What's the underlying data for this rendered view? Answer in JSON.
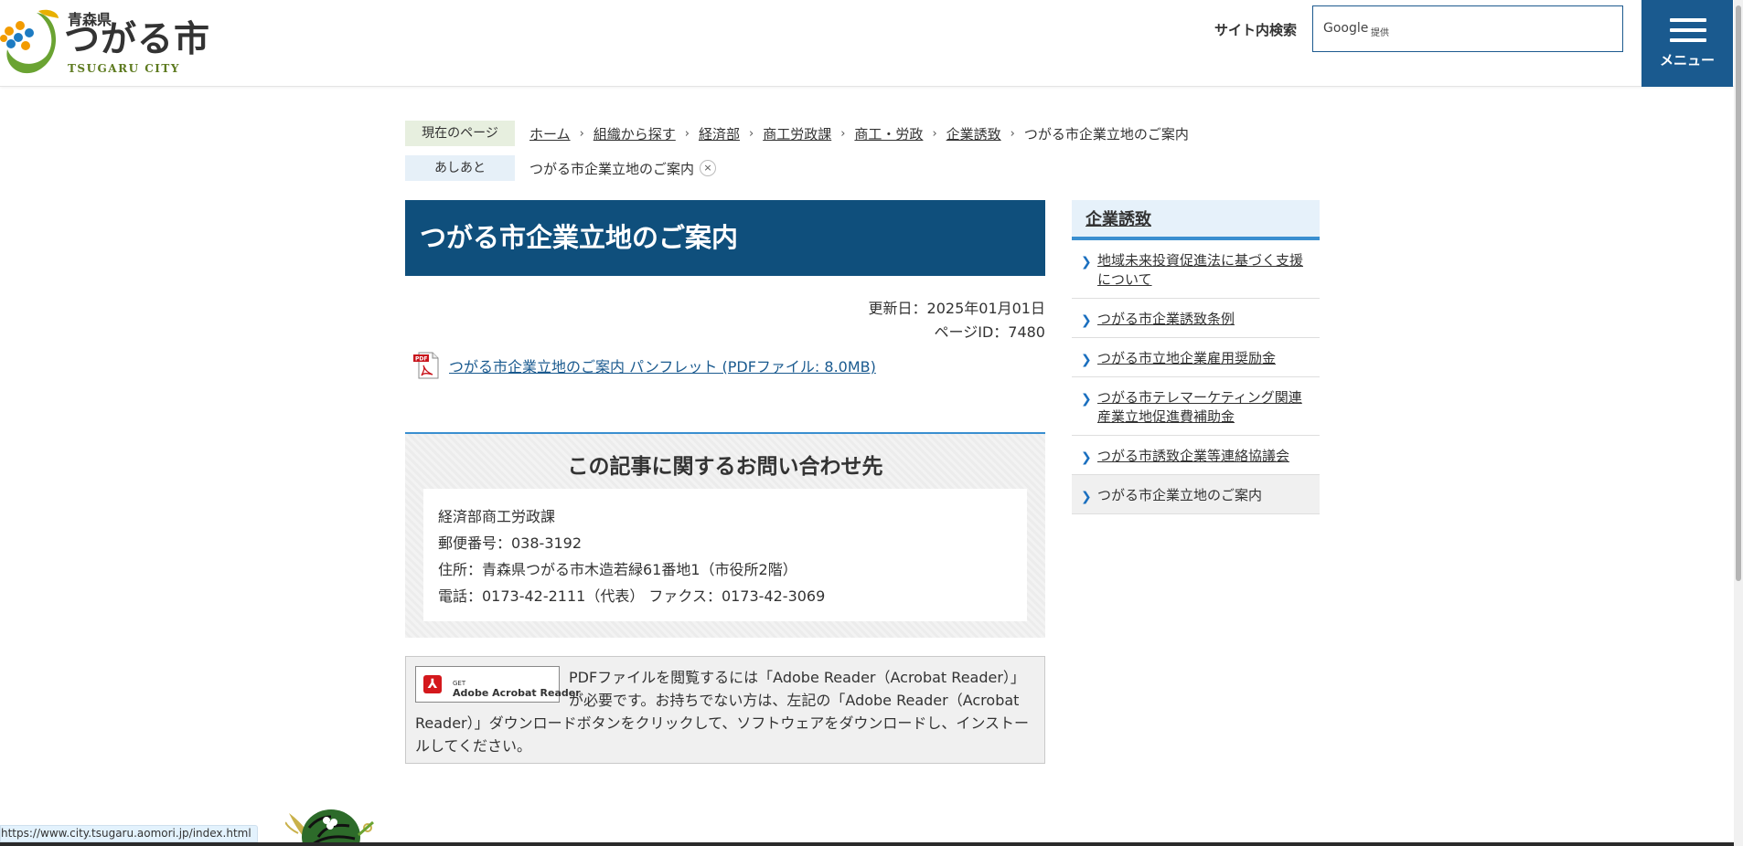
{
  "header": {
    "logo": {
      "prefecture": "青森県",
      "city": "つがる市",
      "english": "TSUGARU CITY"
    },
    "search": {
      "label": "サイト内検索",
      "google_text": "Google",
      "provider_text": "提供",
      "value": ""
    },
    "menu_label": "メニュー"
  },
  "breadcrumb": {
    "label": "現在のページ",
    "items": [
      "ホーム",
      "組織から探す",
      "経済部",
      "商工労政課",
      "商工・労政",
      "企業誘致"
    ],
    "current": "つがる市企業立地のご案内"
  },
  "footprint": {
    "label": "あしあと",
    "item": "つがる市企業立地のご案内",
    "close": "×"
  },
  "main": {
    "title": "つがる市企業立地のご案内",
    "updated": "更新日：2025年01月01日",
    "page_id": "ページID：7480",
    "pdf_link": "つがる市企業立地のご案内 パンフレット (PDFファイル: 8.0MB)"
  },
  "contact": {
    "heading": "この記事に関するお問い合わせ先",
    "department": "経済部商工労政課",
    "postal": "郵便番号：038-3192",
    "address": "住所：青森県つがる市木造若緑61番地1（市役所2階）",
    "phone": "電話：0173-42-2111（代表） ファクス：0173-42-3069"
  },
  "adobe": {
    "button_get": "GET",
    "button_name": "Adobe Acrobat Reader",
    "text": "PDFファイルを閲覧するには「Adobe Reader（Acrobat Reader）」が必要です。お持ちでない方は、左記の「Adobe Reader（Acrobat Reader）」ダウンロードボタンをクリックして、ソフトウェアをダウンロードし、インストールしてください。"
  },
  "sidebar": {
    "title": "企業誘致",
    "items": [
      {
        "label": "地域未来投資促進法に基づく支援について"
      },
      {
        "label": "つがる市企業誘致条例"
      },
      {
        "label": "つがる市立地企業雇用奨励金"
      },
      {
        "label": "つがる市テレマーケティング関連産業立地促進費補助金"
      },
      {
        "label": "つがる市誘致企業等連絡協議会"
      },
      {
        "label": "つがる市企業立地のご案内"
      }
    ]
  },
  "statusbar": {
    "url": "https://www.city.tsugaru.aomori.jp/index.html"
  },
  "colors": {
    "header_blue": "#1a5a8f",
    "title_blue": "#0f4f7c",
    "accent_blue": "#3a8fd0",
    "logo_green": "#5d7a1f"
  }
}
